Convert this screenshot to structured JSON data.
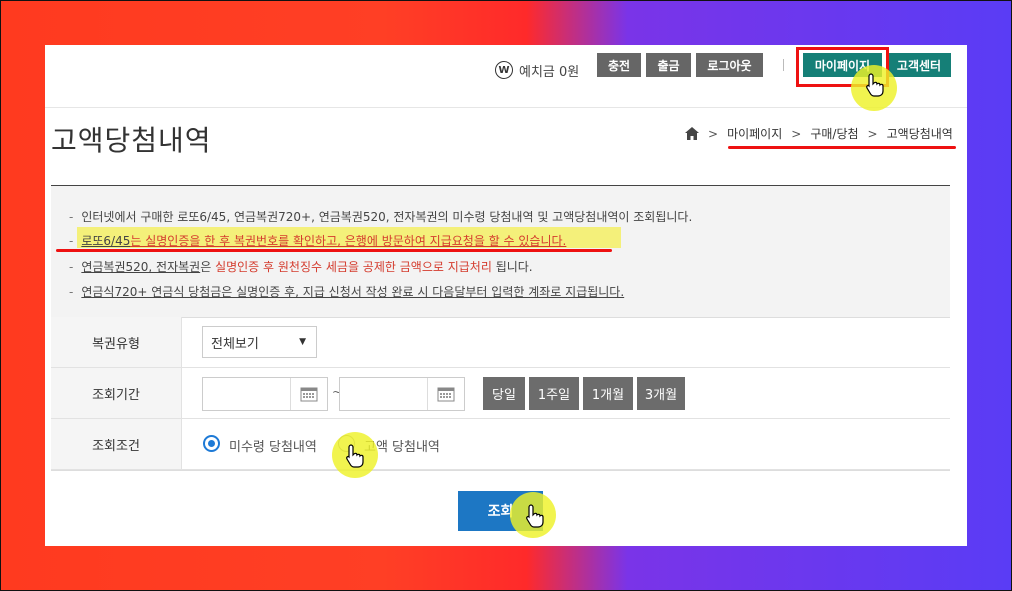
{
  "header": {
    "deposit_icon": "W",
    "deposit_label": "예치금 0원",
    "charge_label": "충전",
    "withdraw_label": "출금",
    "logout_label": "로그아웃",
    "mypage_label": "마이페이지",
    "support_label": "고객센터"
  },
  "page": {
    "title": "고액당첨내역",
    "breadcrumb": [
      "마이페이지",
      "구매/당첨",
      "고액당첨내역"
    ]
  },
  "info": {
    "line1": "인터넷에서 구매한 로또6/45, 연금복권720+, 연금복권520, 전자복권의 미수령 당첨내역 및 고액당첨내역이 조회됩니다.",
    "line2_a": "로또6/45",
    "line2_b": "는 실명인증을 한 후 복권번호를 확인하고, 은행에 방문하여 지급요청을 할 수 있습니다.",
    "line3_a": "연금복권520, 전자복권",
    "line3_b": "은 ",
    "line3_c": "실명인증 후 원천징수 세금을 공제한 금액으로 지급처리",
    "line3_d": " 됩니다.",
    "line4": "연금식720+ 연금식 당첨금은 실명인증 후, 지급 신청서 작성 완료 시 다음달부터 입력한 계좌로 지급됩니다."
  },
  "form": {
    "type_label": "복권유형",
    "type_selected": "전체보기",
    "period_label": "조회기간",
    "period_from": "",
    "period_to": "",
    "period_sep": "~",
    "quick_buttons": [
      "당일",
      "1주일",
      "1개월",
      "3개월"
    ],
    "condition_label": "조회조건",
    "condition_options": [
      "미수령 당첨내역",
      "고액 당첨내역"
    ],
    "condition_selected": "미수령 당첨내역"
  },
  "submit_label": "조회",
  "colors": {
    "teal": "#157f77",
    "submit_blue": "#1d77c4",
    "highlight_red": "#e11111",
    "text_red": "#d43b2d",
    "cursor_highlight": "#eef228"
  }
}
